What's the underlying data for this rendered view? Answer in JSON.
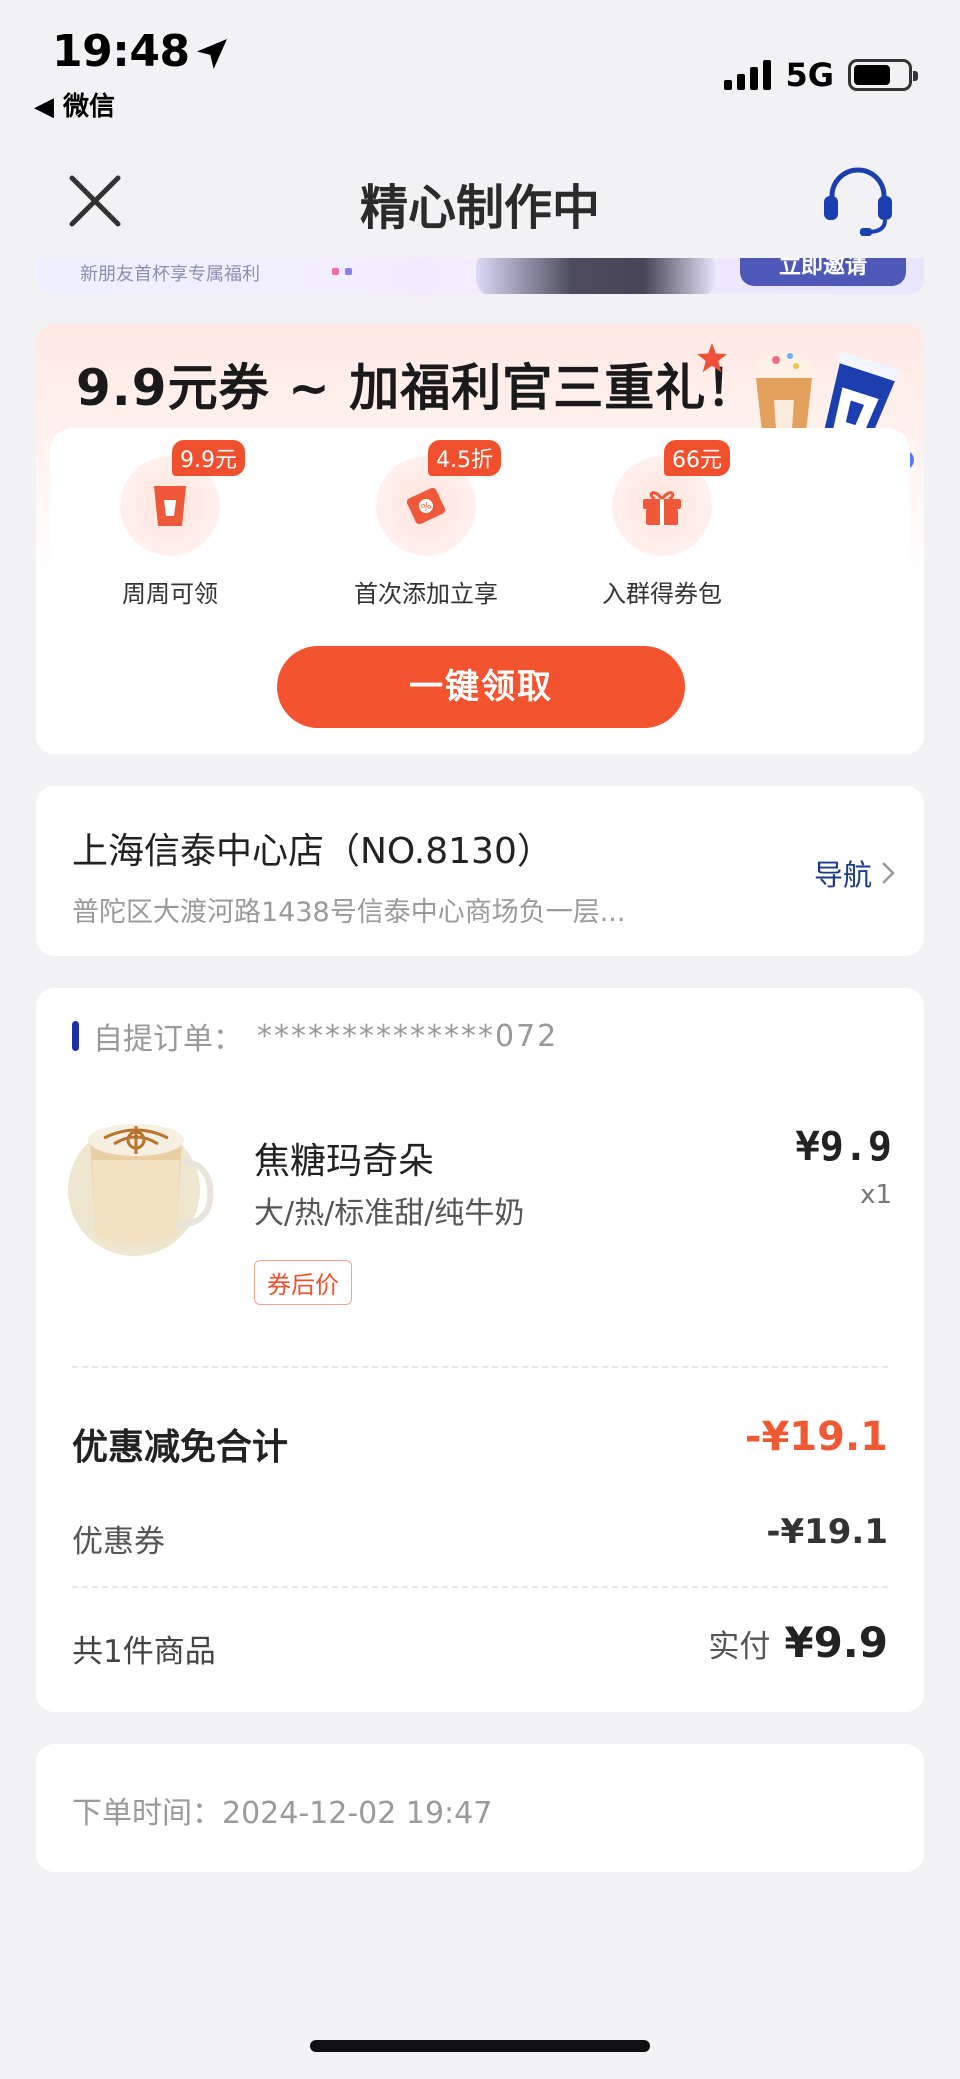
{
  "status_bar": {
    "time": "19:48",
    "back_app": "◀ 微信",
    "network": "5G"
  },
  "nav": {
    "title": "精心制作中",
    "close_icon": "close-icon",
    "service_icon": "headset-icon"
  },
  "top_banner": {
    "text": "新朋友首杯享专属福利",
    "button": "立即邀请"
  },
  "promo": {
    "title": "9.9元券 ~ 加福利官三重礼！",
    "benefits": [
      {
        "badge": "9.9元",
        "label": "周周可领",
        "icon": "coupon-cup-icon"
      },
      {
        "badge": "4.5折",
        "label": "首次添加立享",
        "icon": "ticket-icon"
      },
      {
        "badge": "66元",
        "label": "入群得券包",
        "icon": "gift-icon"
      }
    ],
    "button": "一键领取",
    "accent": "#f4532f"
  },
  "store": {
    "name": "上海信泰中心店（NO.8130）",
    "address": "普陀区大渡河路1438号信泰中心商场负一层...",
    "nav_label": "导航"
  },
  "order": {
    "label": "自提订单：",
    "number": "**************072",
    "product": {
      "name": "焦糖玛奇朵",
      "spec": "大/热/标准甜/纯牛奶",
      "tag": "券后价",
      "price": "¥9.9",
      "qty": "x1"
    },
    "discount_total_label": "优惠减免合计",
    "discount_total_value": "-¥19.1",
    "coupon_label": "优惠券",
    "coupon_value": "-¥19.1",
    "count_label": "共1件商品",
    "paid_label": "实付",
    "paid_value": "¥9.9"
  },
  "order_time": "下单时间：2024-12-02 19:47"
}
